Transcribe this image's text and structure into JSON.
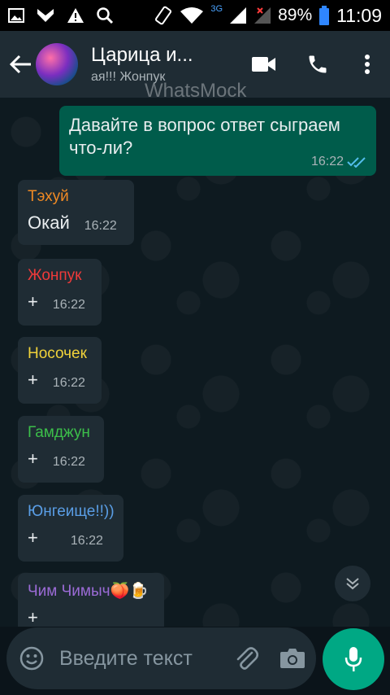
{
  "status_bar": {
    "network_label": "3G",
    "battery": "89%",
    "time": "11:09"
  },
  "header": {
    "title": "Царица и...",
    "subtitle": "ая!!!          Жонпук"
  },
  "watermark": "WhatsMock",
  "messages": [
    {
      "type": "out",
      "text": "Давайте в  вопрос ответ сыграем что-ли?",
      "time": "16:22"
    },
    {
      "type": "in",
      "sender": "Тэхуй",
      "sender_color": "#f08a24",
      "text": "Окай",
      "time": "16:22"
    },
    {
      "type": "in",
      "sender": "Жонпук",
      "sender_color": "#ef3a3a",
      "text": "+",
      "time": "16:22"
    },
    {
      "type": "in",
      "sender": "Носочек",
      "sender_color": "#f0d23a",
      "text": "+",
      "time": "16:22"
    },
    {
      "type": "in",
      "sender": "Гамджун",
      "sender_color": "#3cbf4a",
      "text": "+",
      "time": "16:22"
    },
    {
      "type": "in",
      "sender": "Юнгеище!!))",
      "sender_color": "#5a9ee6",
      "text": "+",
      "time": "16:22"
    },
    {
      "type": "in",
      "sender": "Чим Чимыч🍑🍺",
      "sender_color": "#9b6bd6",
      "text": "+",
      "time": ""
    }
  ],
  "input": {
    "placeholder": "Введите текст"
  },
  "colors": {
    "outgoing_bubble": "#005c4b",
    "incoming_bubble": "#1f2c34",
    "accent": "#00a884",
    "read_ticks": "#53bdeb"
  }
}
